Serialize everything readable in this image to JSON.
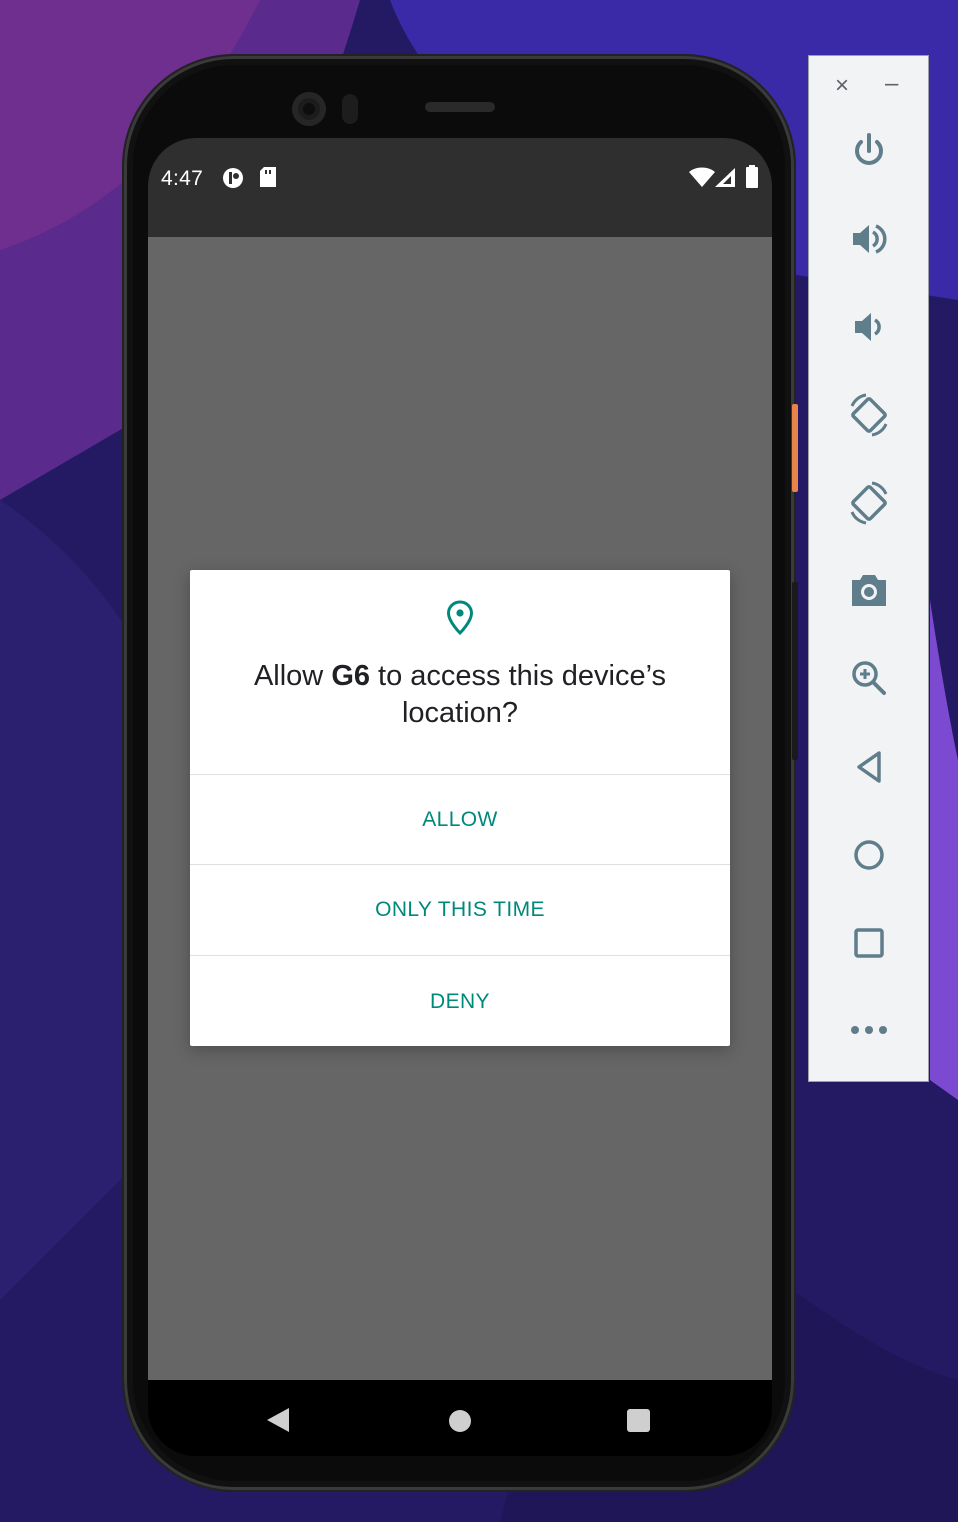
{
  "status_bar": {
    "time": "4:47",
    "left_icons": [
      "app-notification-icon",
      "sd-card-icon"
    ],
    "right_icons": [
      "wifi-icon",
      "cellular-signal-icon",
      "battery-icon"
    ]
  },
  "dialog": {
    "icon": "location-pin-icon",
    "title_prefix": "Allow ",
    "app_name": "G6",
    "title_suffix": " to access this device’s location?",
    "buttons": {
      "allow": "ALLOW",
      "only_this_time": "ONLY THIS TIME",
      "deny": "DENY"
    },
    "accent_color": "#00897b"
  },
  "navigation_bar": {
    "buttons": [
      "back-icon",
      "home-icon",
      "recents-icon"
    ]
  },
  "emulator_panel": {
    "window_controls": {
      "close": "×",
      "minimize": "–"
    },
    "buttons": [
      "power",
      "volume-up",
      "volume-down",
      "rotate-left",
      "rotate-right",
      "screenshot",
      "zoom",
      "back",
      "home",
      "overview",
      "more"
    ]
  }
}
